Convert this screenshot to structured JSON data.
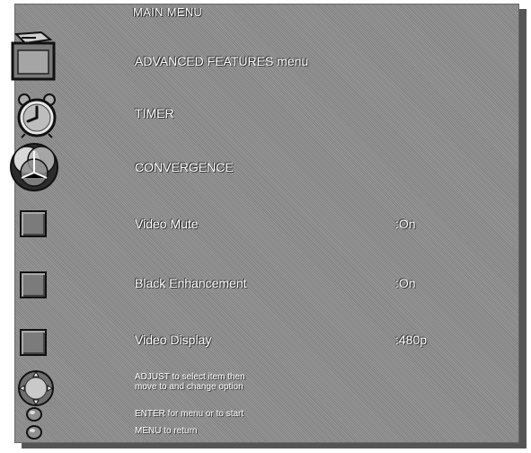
{
  "menu": {
    "title": "MAIN MENU",
    "items": [
      {
        "label": "ADVANCED FEATURES menu",
        "icon": "folder-icon"
      },
      {
        "label": "TIMER",
        "icon": "alarm-clock-icon"
      },
      {
        "label": "CONVERGENCE",
        "icon": "convergence-icon"
      },
      {
        "label": "Video Mute",
        "value": ":On",
        "icon": "checkbox-icon"
      },
      {
        "label": "Black Enhancement",
        "value": ":On",
        "icon": "checkbox-icon"
      },
      {
        "label": "Video Display",
        "value": ":480p",
        "icon": "checkbox-icon"
      }
    ],
    "help": {
      "adjust_line1": "ADJUST to select item then",
      "adjust_line2": "move to and change option",
      "enter": "ENTER for menu or to start",
      "menu": "MENU to return"
    },
    "help_icons": [
      "joystick-icon",
      "enter-button-icon",
      "menu-button-icon"
    ]
  }
}
